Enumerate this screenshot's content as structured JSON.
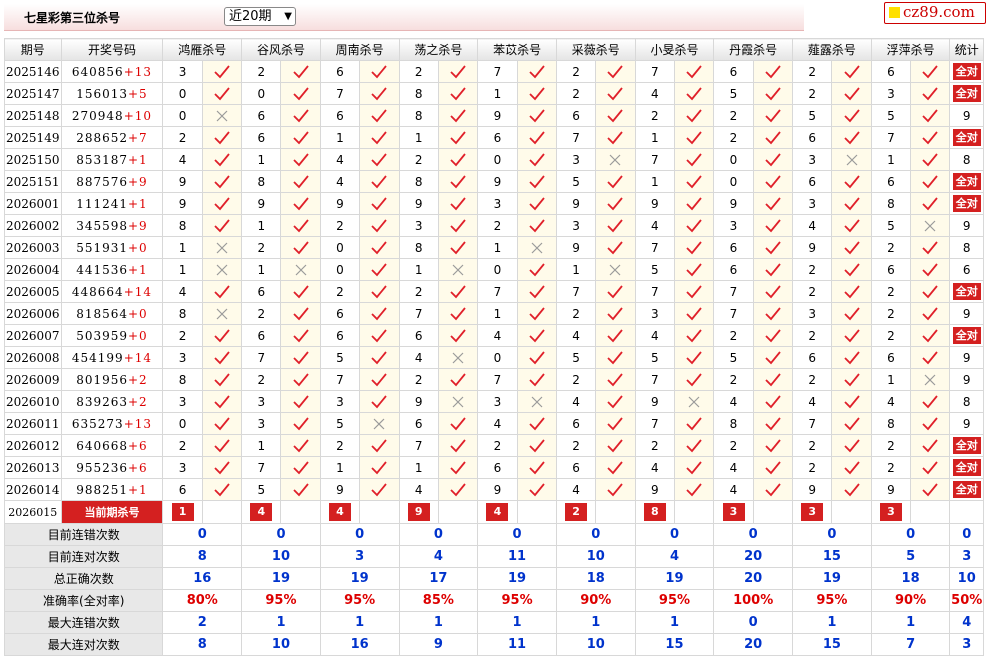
{
  "header": {
    "title": "七星彩第三位杀号",
    "range_select": "近20期",
    "logo_text": "cz89.com"
  },
  "columns": [
    "期号",
    "开奖号码",
    "鸿雁杀号",
    "谷风杀号",
    "周南杀号",
    "荡之杀号",
    "苯苡杀号",
    "采薇杀号",
    "小旻杀号",
    "丹霞杀号",
    "薤露杀号",
    "浮萍杀号",
    "统计"
  ],
  "rows": [
    {
      "period": "2025146",
      "digits": "640856",
      "plus": "+13",
      "kills": [
        3,
        2,
        6,
        2,
        7,
        2,
        7,
        6,
        2,
        6
      ],
      "ok": [
        1,
        1,
        1,
        1,
        1,
        1,
        1,
        1,
        1,
        1
      ],
      "stat": "全对"
    },
    {
      "period": "2025147",
      "digits": "156013",
      "plus": "+5",
      "kills": [
        0,
        0,
        7,
        8,
        1,
        2,
        4,
        5,
        2,
        3
      ],
      "ok": [
        1,
        1,
        1,
        1,
        1,
        1,
        1,
        1,
        1,
        1
      ],
      "stat": "全对"
    },
    {
      "period": "2025148",
      "digits": "270948",
      "plus": "+10",
      "kills": [
        0,
        6,
        6,
        8,
        9,
        6,
        2,
        2,
        5,
        5
      ],
      "ok": [
        0,
        1,
        1,
        1,
        1,
        1,
        1,
        1,
        1,
        1
      ],
      "stat": "9"
    },
    {
      "period": "2025149",
      "digits": "288652",
      "plus": "+7",
      "kills": [
        2,
        6,
        1,
        1,
        6,
        7,
        1,
        2,
        6,
        7
      ],
      "ok": [
        1,
        1,
        1,
        1,
        1,
        1,
        1,
        1,
        1,
        1
      ],
      "stat": "全对"
    },
    {
      "period": "2025150",
      "digits": "853187",
      "plus": "+1",
      "kills": [
        4,
        1,
        4,
        2,
        0,
        3,
        7,
        0,
        3,
        1
      ],
      "ok": [
        1,
        1,
        1,
        1,
        1,
        0,
        1,
        1,
        0,
        1
      ],
      "stat": "8"
    },
    {
      "period": "2025151",
      "digits": "887576",
      "plus": "+9",
      "kills": [
        9,
        8,
        4,
        8,
        9,
        5,
        1,
        0,
        6,
        6
      ],
      "ok": [
        1,
        1,
        1,
        1,
        1,
        1,
        1,
        1,
        1,
        1
      ],
      "stat": "全对"
    },
    {
      "period": "2026001",
      "digits": "111241",
      "plus": "+1",
      "kills": [
        9,
        9,
        9,
        9,
        3,
        9,
        9,
        9,
        3,
        8
      ],
      "ok": [
        1,
        1,
        1,
        1,
        1,
        1,
        1,
        1,
        1,
        1
      ],
      "stat": "全对"
    },
    {
      "period": "2026002",
      "digits": "345598",
      "plus": "+9",
      "kills": [
        8,
        1,
        2,
        3,
        2,
        3,
        4,
        3,
        4,
        5
      ],
      "ok": [
        1,
        1,
        1,
        1,
        1,
        1,
        1,
        1,
        1,
        0
      ],
      "stat": "9"
    },
    {
      "period": "2026003",
      "digits": "551931",
      "plus": "+0",
      "kills": [
        1,
        2,
        0,
        8,
        1,
        9,
        7,
        6,
        9,
        2
      ],
      "ok": [
        0,
        1,
        1,
        1,
        0,
        1,
        1,
        1,
        1,
        1
      ],
      "stat": "8"
    },
    {
      "period": "2026004",
      "digits": "441536",
      "plus": "+1",
      "kills": [
        1,
        1,
        0,
        1,
        0,
        1,
        5,
        6,
        2,
        6
      ],
      "ok": [
        0,
        0,
        1,
        0,
        1,
        0,
        1,
        1,
        1,
        1
      ],
      "stat": "6"
    },
    {
      "period": "2026005",
      "digits": "448664",
      "plus": "+14",
      "kills": [
        4,
        6,
        2,
        2,
        7,
        7,
        7,
        7,
        2,
        2
      ],
      "ok": [
        1,
        1,
        1,
        1,
        1,
        1,
        1,
        1,
        1,
        1
      ],
      "stat": "全对"
    },
    {
      "period": "2026006",
      "digits": "818564",
      "plus": "+0",
      "kills": [
        8,
        2,
        6,
        7,
        1,
        2,
        3,
        7,
        3,
        2
      ],
      "ok": [
        0,
        1,
        1,
        1,
        1,
        1,
        1,
        1,
        1,
        1
      ],
      "stat": "9"
    },
    {
      "period": "2026007",
      "digits": "503959",
      "plus": "+0",
      "kills": [
        2,
        6,
        6,
        6,
        4,
        4,
        4,
        2,
        2,
        2
      ],
      "ok": [
        1,
        1,
        1,
        1,
        1,
        1,
        1,
        1,
        1,
        1
      ],
      "stat": "全对"
    },
    {
      "period": "2026008",
      "digits": "454199",
      "plus": "+14",
      "kills": [
        3,
        7,
        5,
        4,
        0,
        5,
        5,
        5,
        6,
        6
      ],
      "ok": [
        1,
        1,
        1,
        0,
        1,
        1,
        1,
        1,
        1,
        1
      ],
      "stat": "9"
    },
    {
      "period": "2026009",
      "digits": "801956",
      "plus": "+2",
      "kills": [
        8,
        2,
        7,
        2,
        7,
        2,
        7,
        2,
        2,
        1
      ],
      "ok": [
        1,
        1,
        1,
        1,
        1,
        1,
        1,
        1,
        1,
        0
      ],
      "stat": "9"
    },
    {
      "period": "2026010",
      "digits": "839263",
      "plus": "+2",
      "kills": [
        3,
        3,
        3,
        9,
        3,
        4,
        9,
        4,
        4,
        4
      ],
      "ok": [
        1,
        1,
        1,
        0,
        0,
        1,
        0,
        1,
        1,
        1
      ],
      "stat": "8"
    },
    {
      "period": "2026011",
      "digits": "635273",
      "plus": "+13",
      "kills": [
        0,
        3,
        5,
        6,
        4,
        6,
        7,
        8,
        7,
        8
      ],
      "ok": [
        1,
        1,
        0,
        1,
        1,
        1,
        1,
        1,
        1,
        1
      ],
      "stat": "9"
    },
    {
      "period": "2026012",
      "digits": "640668",
      "plus": "+6",
      "kills": [
        2,
        1,
        2,
        7,
        2,
        2,
        2,
        2,
        2,
        2
      ],
      "ok": [
        1,
        1,
        1,
        1,
        1,
        1,
        1,
        1,
        1,
        1
      ],
      "stat": "全对"
    },
    {
      "period": "2026013",
      "digits": "955236",
      "plus": "+6",
      "kills": [
        3,
        7,
        1,
        1,
        6,
        6,
        4,
        4,
        2,
        2
      ],
      "ok": [
        1,
        1,
        1,
        1,
        1,
        1,
        1,
        1,
        1,
        1
      ],
      "stat": "全对"
    },
    {
      "period": "2026014",
      "digits": "988251",
      "plus": "+1",
      "kills": [
        6,
        5,
        9,
        4,
        9,
        4,
        9,
        4,
        9,
        9
      ],
      "ok": [
        1,
        1,
        1,
        1,
        1,
        1,
        1,
        1,
        1,
        1
      ],
      "stat": "全对"
    }
  ],
  "current": {
    "period": "2026015",
    "label": "当前期杀号",
    "kills": [
      1,
      4,
      4,
      9,
      4,
      2,
      8,
      3,
      3,
      3
    ]
  },
  "summary": [
    {
      "label": "目前连错次数",
      "values": [
        "0",
        "0",
        "0",
        "0",
        "0",
        "0",
        "0",
        "0",
        "0",
        "0",
        "0"
      ],
      "red": false
    },
    {
      "label": "目前连对次数",
      "values": [
        "8",
        "10",
        "3",
        "4",
        "11",
        "10",
        "4",
        "20",
        "15",
        "5",
        "3"
      ],
      "red": false
    },
    {
      "label": "总正确次数",
      "values": [
        "16",
        "19",
        "19",
        "17",
        "19",
        "18",
        "19",
        "20",
        "19",
        "18",
        "10"
      ],
      "red": false
    },
    {
      "label": "准确率(全对率)",
      "values": [
        "80%",
        "95%",
        "95%",
        "85%",
        "95%",
        "90%",
        "95%",
        "100%",
        "95%",
        "90%",
        "50%"
      ],
      "red": true
    },
    {
      "label": "最大连错次数",
      "values": [
        "2",
        "1",
        "1",
        "1",
        "1",
        "1",
        "1",
        "0",
        "1",
        "1",
        "4"
      ],
      "red": false
    },
    {
      "label": "最大连对次数",
      "values": [
        "8",
        "10",
        "16",
        "9",
        "11",
        "10",
        "15",
        "20",
        "15",
        "7",
        "3"
      ],
      "red": false
    }
  ],
  "colors": {
    "check": "#e0202a",
    "cross": "#9a9a9a",
    "badge": "#d42020",
    "summary_value": "#0033cc"
  }
}
